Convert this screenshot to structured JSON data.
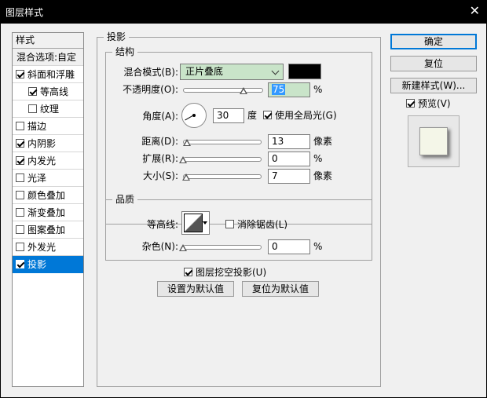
{
  "window": {
    "title": "图层样式",
    "close_glyph": "✕"
  },
  "stylelist": {
    "header": "样式",
    "blend_options": "混合选项:自定",
    "items": [
      {
        "label": "斜面和浮雕",
        "checked": true,
        "sub": false,
        "selected": false
      },
      {
        "label": "等高线",
        "checked": true,
        "sub": true,
        "selected": false
      },
      {
        "label": "纹理",
        "checked": false,
        "sub": true,
        "selected": false
      },
      {
        "label": "描边",
        "checked": false,
        "sub": false,
        "selected": false
      },
      {
        "label": "内阴影",
        "checked": true,
        "sub": false,
        "selected": false
      },
      {
        "label": "内发光",
        "checked": true,
        "sub": false,
        "selected": false
      },
      {
        "label": "光泽",
        "checked": false,
        "sub": false,
        "selected": false
      },
      {
        "label": "颜色叠加",
        "checked": false,
        "sub": false,
        "selected": false
      },
      {
        "label": "渐变叠加",
        "checked": false,
        "sub": false,
        "selected": false
      },
      {
        "label": "图案叠加",
        "checked": false,
        "sub": false,
        "selected": false
      },
      {
        "label": "外发光",
        "checked": false,
        "sub": false,
        "selected": false
      },
      {
        "label": "投影",
        "checked": true,
        "sub": false,
        "selected": true
      }
    ]
  },
  "drop_shadow": {
    "title": "投影",
    "structure": {
      "title": "结构",
      "blend_mode_label": "混合模式(B):",
      "blend_mode_value": "正片叠底",
      "shadow_color": "#000000",
      "opacity_label": "不透明度(O):",
      "opacity_value": "75",
      "opacity_unit": "%",
      "opacity_fraction": 0.75,
      "angle_label": "角度(A):",
      "angle_value": "30",
      "angle_degrees": 30,
      "angle_unit": "度",
      "global_light_label": "使用全局光(G)",
      "global_light_checked": true,
      "distance_label": "距离(D):",
      "distance_value": "13",
      "distance_unit": "像素",
      "distance_fraction": 0.05,
      "spread_label": "扩展(R):",
      "spread_value": "0",
      "spread_unit": "%",
      "spread_fraction": 0,
      "size_label": "大小(S):",
      "size_value": "7",
      "size_unit": "像素",
      "size_fraction": 0.04
    },
    "quality": {
      "title": "品质",
      "contour_label": "等高线:",
      "antialias_label": "消除锯齿(L)",
      "antialias_checked": false,
      "noise_label": "杂色(N):",
      "noise_value": "0",
      "noise_unit": "%",
      "noise_fraction": 0
    },
    "knockout_label": "图层挖空投影(U)",
    "knockout_checked": true,
    "make_default": "设置为默认值",
    "reset_default": "复位为默认值"
  },
  "side": {
    "ok": "确定",
    "reset": "复位",
    "new_style": "新建样式(W)...",
    "preview_label": "预览(V)",
    "preview_checked": true,
    "preview_fill": "#f4f6e8"
  }
}
